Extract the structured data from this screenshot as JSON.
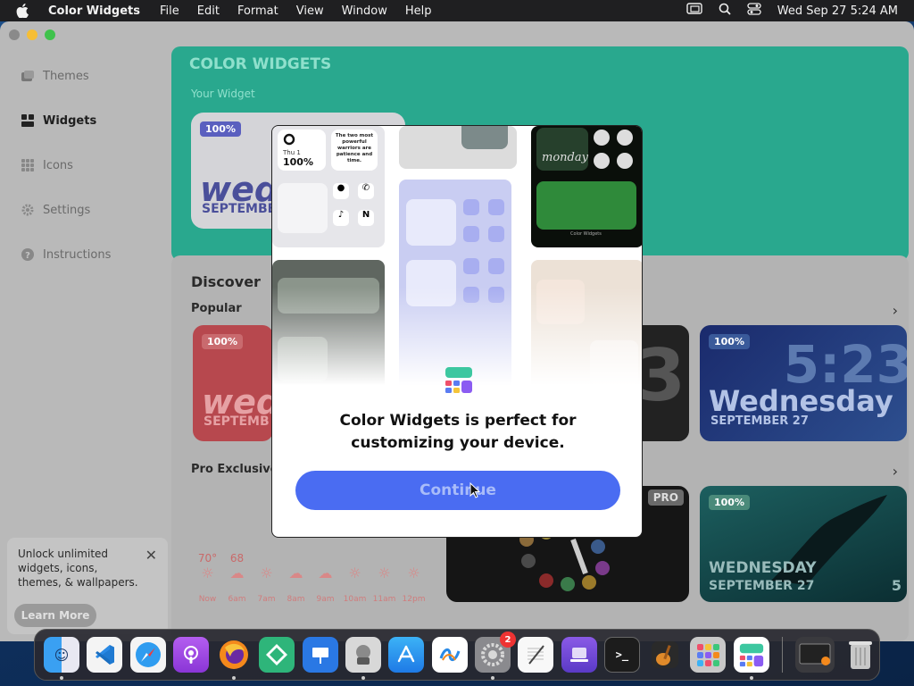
{
  "menubar": {
    "app_name": "Color Widgets",
    "menus": [
      "File",
      "Edit",
      "Format",
      "View",
      "Window",
      "Help"
    ],
    "clock": "Wed Sep 27  5:24 AM"
  },
  "sidebar": {
    "items": [
      {
        "label": "Themes",
        "icon": "themes-icon"
      },
      {
        "label": "Widgets",
        "icon": "widgets-icon",
        "active": true
      },
      {
        "label": "Icons",
        "icon": "icons-grid-icon"
      },
      {
        "label": "Settings",
        "icon": "gear-icon"
      },
      {
        "label": "Instructions",
        "icon": "help-icon"
      }
    ]
  },
  "unlock_banner": {
    "text": "Unlock unlimited widgets, icons, themes, & wallpapers.",
    "button": "Learn More"
  },
  "header": {
    "title": "COLOR WIDGETS",
    "subtitle": "Your Widget",
    "widget": {
      "badge": "100%",
      "day": "wed",
      "date": "SEPTEMBE"
    }
  },
  "discover": {
    "title": "Discover",
    "popular_label": "Popular",
    "pro_label": "Pro Exclusives",
    "popular_cards": {
      "red": {
        "badge": "100%",
        "day": "wed",
        "date": "SEPTEMB"
      },
      "dark": {
        "number": "3"
      },
      "blue": {
        "badge": "100%",
        "time": "5:23",
        "day": "Wednesday",
        "date": "SEPTEMBER 27"
      }
    },
    "pro_cards": {
      "dark": {
        "badge": "PRO"
      },
      "whale": {
        "badge": "100%",
        "day": "WEDNESDAY",
        "date": "SEPTEMBER 27",
        "number": "5"
      }
    },
    "weather": [
      {
        "temp": "70°",
        "time": "Now",
        "icon": "sun-icon"
      },
      {
        "temp": "68",
        "time": "6am",
        "icon": "cloud-icon"
      },
      {
        "temp": "",
        "time": "7am",
        "icon": "sun-icon"
      },
      {
        "temp": "",
        "time": "8am",
        "icon": "cloud-icon"
      },
      {
        "temp": "",
        "time": "9am",
        "icon": "cloud-icon"
      },
      {
        "temp": "",
        "time": "10am",
        "icon": "sun-icon"
      },
      {
        "temp": "",
        "time": "11am",
        "icon": "sun-icon"
      },
      {
        "temp": "",
        "time": "12pm",
        "icon": "sun-icon"
      }
    ]
  },
  "modal": {
    "message": "Color Widgets is perfect for customizing your device.",
    "continue_label": "Continue",
    "preview": {
      "percent": "100%",
      "thu": "Thu 1",
      "quote": "The two most powerful warriors are patience and time.",
      "monday": "monday",
      "caption": "Color Widgets"
    }
  },
  "dock": {
    "apps": [
      "Finder",
      "Visual Studio Code",
      "Safari",
      "Podcasts",
      "Firefox",
      "Tasks",
      "Keynote",
      "Automator",
      "App Store",
      "Freeform",
      "System Settings",
      "TextEdit",
      "Apple Configurator",
      "Terminal",
      "GarageBand",
      "Launchpad",
      "Color Widgets"
    ],
    "settings_badge": "2"
  },
  "colors": {
    "teal": "#29a88e",
    "accent_blue": "#4a6cf2"
  }
}
